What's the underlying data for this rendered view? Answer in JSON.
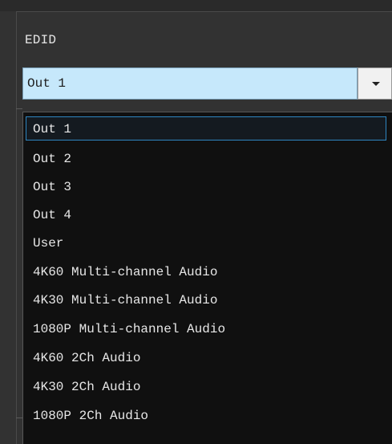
{
  "edid": {
    "label": "EDID",
    "selected_value": "Out 1",
    "options": [
      "Out 1",
      "Out 2",
      "Out 3",
      "Out 4",
      "User",
      "4K60 Multi-channel Audio",
      "4K30 Multi-channel Audio",
      "1080P Multi-channel Audio",
      "4K60 2Ch Audio",
      "4K30 2Ch Audio",
      "1080P 2Ch Audio"
    ]
  },
  "colors": {
    "background": "#323232",
    "dropdown_background": "#101010",
    "selection_border": "#2e86c1",
    "combo_field": "#c6e8fb"
  },
  "icons": {
    "combo_arrow": "chevron-down-icon"
  }
}
